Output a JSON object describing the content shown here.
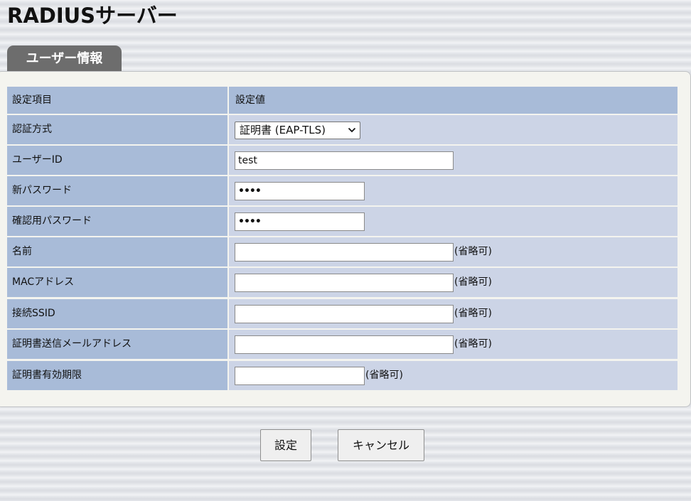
{
  "page": {
    "title": "RADIUSサーバー",
    "tab_label": "ユーザー情報"
  },
  "table": {
    "header": {
      "item": "設定項目",
      "value": "設定値"
    },
    "rows": [
      {
        "label": "認証方式",
        "select_value": "証明書 (EAP-TLS)"
      },
      {
        "label": "ユーザーID",
        "value": "test"
      },
      {
        "label": "新パスワード",
        "value": "••••"
      },
      {
        "label": "確認用パスワード",
        "value": "••••"
      },
      {
        "label": "名前",
        "value": "",
        "note": "(省略可)"
      },
      {
        "label": "MACアドレス",
        "value": "",
        "note": "(省略可)"
      },
      {
        "label": "接続SSID",
        "value": "",
        "note": "(省略可)"
      },
      {
        "label": "証明書送信メールアドレス",
        "value": "",
        "note": "(省略可)"
      },
      {
        "label": "証明書有効期限",
        "value": "",
        "note": "(省略可)"
      }
    ]
  },
  "buttons": {
    "submit": "設定",
    "cancel": "キャンセル"
  },
  "colors": {
    "label_cell": "#a8bbd8",
    "value_cell": "#ccd4e6",
    "tab": "#6d6d6d",
    "panel": "#f4f4ef"
  },
  "icons": {
    "select_arrow": "chevron-down-icon"
  }
}
